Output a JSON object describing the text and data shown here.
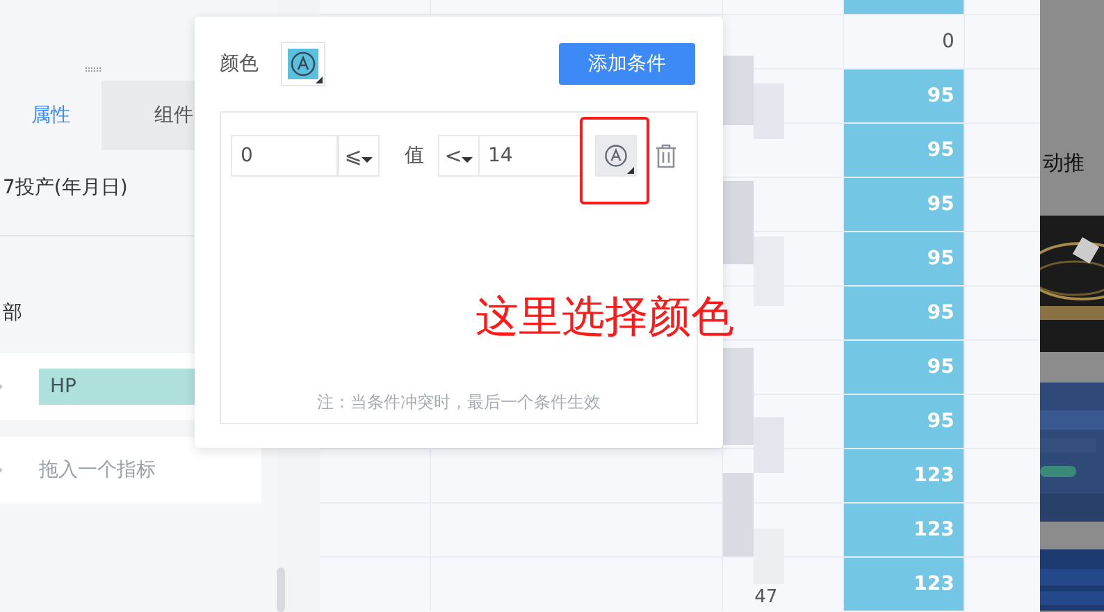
{
  "left_panel": {
    "tabs": [
      {
        "label": "属性",
        "selected": true
      },
      {
        "label": "组件",
        "selected": false
      }
    ],
    "field_label": "7投产(年月日)",
    "group_label": "部",
    "rows": [
      {
        "kind": "pill",
        "text": "HP"
      },
      {
        "kind": "placeholder",
        "text": "拖入一个指标"
      }
    ]
  },
  "table": {
    "rows": [
      {
        "value": "0"
      },
      {
        "value": "95",
        "color": "#74c7e4"
      },
      {
        "value": "95",
        "color": "#74c7e4"
      },
      {
        "value": "95",
        "color": "#74c7e4"
      },
      {
        "value": "95",
        "color": "#74c7e4"
      },
      {
        "value": "95",
        "color": "#74c7e4"
      },
      {
        "value": "95",
        "color": "#74c7e4"
      },
      {
        "value": "95",
        "color": "#74c7e4"
      },
      {
        "value": "123",
        "color": "#74c7e4"
      },
      {
        "value": "123",
        "color": "#74c7e4"
      },
      {
        "value": "123",
        "color": "#74c7e4",
        "column_2": "47"
      }
    ]
  },
  "side_strip": {
    "heading": "动推"
  },
  "popup": {
    "color_label": "颜色",
    "color": "#5bc0de",
    "add_button": "添加条件",
    "condition": {
      "min": "0",
      "min_operator": "⩽",
      "value_label": "值",
      "max_operator": "<",
      "max": "14"
    },
    "note": "注：当条件冲突时，最后一个条件生效"
  },
  "annotation": {
    "text": "这里选择颜色"
  }
}
